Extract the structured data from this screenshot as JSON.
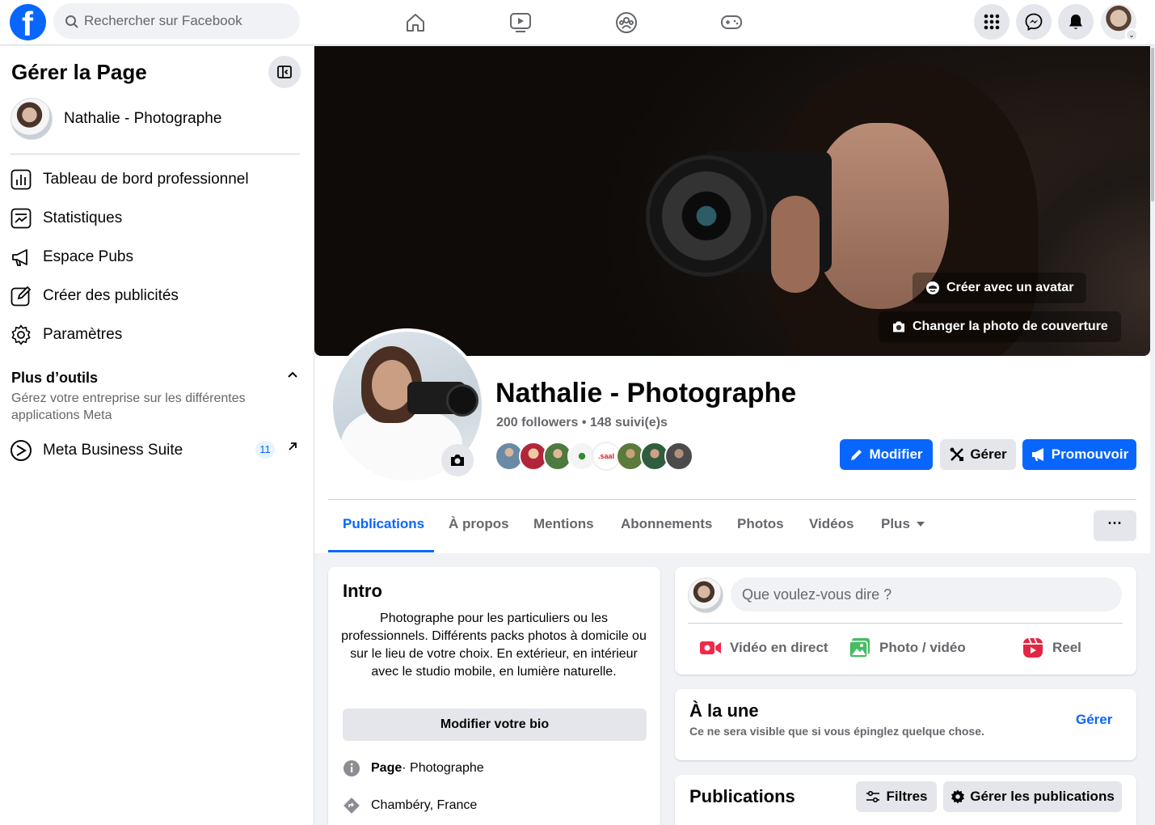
{
  "topbar": {
    "logo": "f",
    "search_placeholder": "Rechercher sur Facebook",
    "nav_icons": [
      "home-icon",
      "watch-icon",
      "groups-icon",
      "gaming-icon"
    ],
    "right_icons": [
      "menu-grid-icon",
      "messenger-icon",
      "notifications-icon"
    ]
  },
  "sidebar": {
    "title": "Gérer la Page",
    "page_name": "Nathalie - Photographe",
    "items": [
      {
        "label": "Tableau de bord professionnel",
        "icon": "dashboard-icon"
      },
      {
        "label": "Statistiques",
        "icon": "insights-icon"
      },
      {
        "label": "Espace Pubs",
        "icon": "megaphone-icon"
      },
      {
        "label": "Créer des publicités",
        "icon": "edit-icon"
      },
      {
        "label": "Paramètres",
        "icon": "gear-icon"
      }
    ],
    "tools_title": "Plus d’outils",
    "tools_subtitle": "Gérez votre entreprise sur les différentes applications Meta",
    "meta_suite": {
      "label": "Meta Business Suite",
      "badge": "11"
    }
  },
  "cover": {
    "avatar_button": "Créer avec un avatar",
    "change_cover_button": "Changer la photo de couverture"
  },
  "profile": {
    "name": "Nathalie - Photographe",
    "stats": "200 followers • 148 suivi(e)s",
    "buttons": {
      "edit": "Modifier",
      "manage": "Gérer",
      "promote": "Promouvoir"
    }
  },
  "tabs": [
    {
      "label": "Publications",
      "active": true
    },
    {
      "label": "À propos",
      "active": false
    },
    {
      "label": "Mentions",
      "active": false
    },
    {
      "label": "Abonnements",
      "active": false
    },
    {
      "label": "Photos",
      "active": false
    },
    {
      "label": "Vidéos",
      "active": false
    },
    {
      "label": "Plus",
      "active": false
    }
  ],
  "more_button": "···",
  "intro": {
    "title": "Intro",
    "bio": "Photographe pour les particuliers ou les professionnels. Différents packs photos à domicile ou sur le lieu de votre choix. En extérieur, en intérieur avec le studio mobile, en lumière naturelle.",
    "edit_bio": "Modifier votre bio",
    "category_label": "Page",
    "category_value": " · Photographe",
    "location": "Chambéry, France"
  },
  "composer": {
    "placeholder": "Que voulez-vous dire ?",
    "actions": [
      {
        "label": "Vidéo en direct",
        "color": "#f02849"
      },
      {
        "label": "Photo / vidéo",
        "color": "#45bd62"
      },
      {
        "label": "Reel",
        "color": "#e42645"
      }
    ]
  },
  "featured": {
    "title": "À la une",
    "subtitle": "Ce ne sera visible que si vous épinglez quelque chose.",
    "manage": "Gérer"
  },
  "publications": {
    "title": "Publications",
    "filters": "Filtres",
    "manage": "Gérer les publications"
  },
  "colors": {
    "accent": "#0866ff",
    "gray_button": "#e4e6eb",
    "background": "#f0f2f5"
  }
}
